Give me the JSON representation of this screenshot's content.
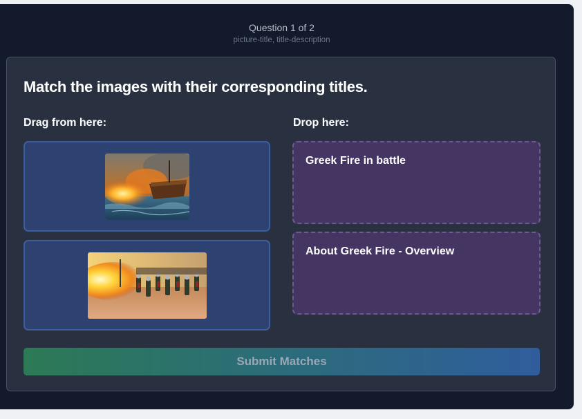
{
  "header": {
    "counter": "Question 1 of 2",
    "type": "picture-title, title-description"
  },
  "card": {
    "title": "Match the images with their corresponding titles.",
    "drag_label": "Drag from here:",
    "drop_label": "Drop here:",
    "drag_items": [
      {
        "image": "greek-fire-ship-image"
      },
      {
        "image": "flamethrower-army-image"
      }
    ],
    "drop_zones": [
      {
        "label": "Greek Fire in battle"
      },
      {
        "label": "About Greek Fire - Overview"
      }
    ],
    "submit_label": "Submit Matches"
  }
}
